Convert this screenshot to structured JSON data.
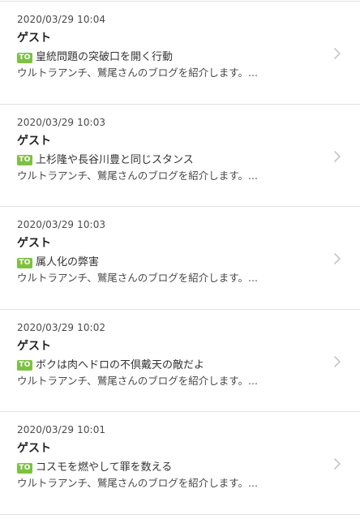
{
  "entries": [
    {
      "date": "2020/03/29 10:04",
      "author": "ゲスト",
      "badge": "TO",
      "title": "皇統問題の突破口を開く行動",
      "excerpt": "ウルトラアンチ、鷲尾さんのブログを紹介します。..."
    },
    {
      "date": "2020/03/29 10:03",
      "author": "ゲスト",
      "badge": "TO",
      "title": "上杉隆や長谷川豊と同じスタンス",
      "excerpt": "ウルトラアンチ、鷲尾さんのブログを紹介します。..."
    },
    {
      "date": "2020/03/29 10:03",
      "author": "ゲスト",
      "badge": "TO",
      "title": "属人化の弊害",
      "excerpt": "ウルトラアンチ、鷲尾さんのブログを紹介します。..."
    },
    {
      "date": "2020/03/29 10:02",
      "author": "ゲスト",
      "badge": "TO",
      "title": "ボクは肉へドロの不倶戴天の敵だよ",
      "excerpt": "ウルトラアンチ、鷲尾さんのブログを紹介します。..."
    },
    {
      "date": "2020/03/29 10:01",
      "author": "ゲスト",
      "badge": "TO",
      "title": "コスモを燃やして罪を数える",
      "excerpt": "ウルトラアンチ、鷲尾さんのブログを紹介します。..."
    }
  ],
  "icons": {
    "chevron": "chevron-right-icon"
  },
  "colors": {
    "badge_background": "#7cc242",
    "divider": "#e2e2e2",
    "chevron": "#c7c7cc"
  }
}
